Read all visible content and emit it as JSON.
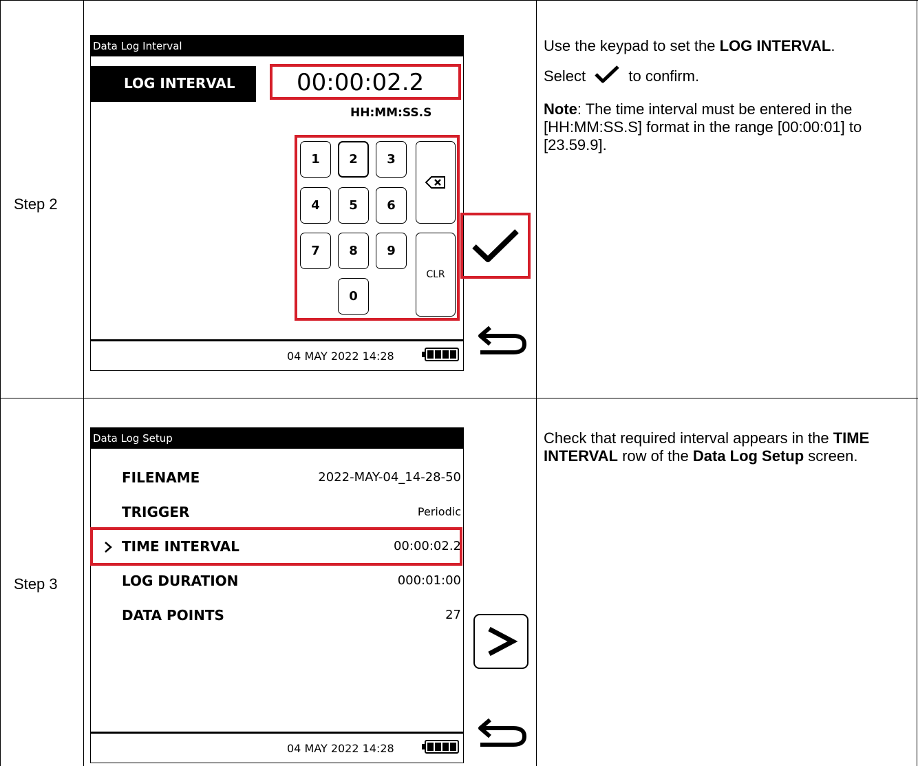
{
  "steps": [
    {
      "label": "Step 2",
      "screen": {
        "title": "Data Log Interval",
        "field_label": "LOG INTERVAL",
        "field_value": "00:00:02.2",
        "format_hint": "HH:MM:SS.S",
        "keys": [
          "1",
          "2",
          "3",
          "4",
          "5",
          "6",
          "7",
          "8",
          "9",
          "0"
        ],
        "clear_label": "CLR",
        "datetime": "04 MAY 2022 14:28"
      },
      "desc": {
        "p1_pre": "Use the keypad to set the ",
        "p1_bold": "LOG INTERVAL",
        "p1_post": ".",
        "p2_pre": "Select ",
        "p2_post": " to confirm.",
        "p3_bold": "Note",
        "p3_post": ": The time interval must be entered in the [HH:MM:SS.S] format in the range [00:00:01] to [23.59.9]."
      }
    },
    {
      "label": "Step 3",
      "screen": {
        "title": "Data Log Setup",
        "rows": [
          {
            "label": "FILENAME",
            "value": "2022-MAY-04_14-28-50"
          },
          {
            "label": "TRIGGER",
            "value": "Periodic"
          },
          {
            "label": "TIME INTERVAL",
            "value": "00:00:02.2"
          },
          {
            "label": "LOG DURATION",
            "value": "000:01:00"
          },
          {
            "label": "DATA POINTS",
            "value": "27"
          }
        ],
        "datetime": "04 MAY 2022 14:28"
      },
      "desc": {
        "t1": "Check that required interval appears in the ",
        "b1": "TIME INTERVAL",
        "t2": " row of the ",
        "b2": "Data Log Setup",
        "t3": " screen."
      }
    }
  ],
  "icons": {
    "confirm": "checkmark-icon",
    "back": "back-arrow-icon",
    "next": "chevron-right-icon",
    "backspace": "backspace-icon",
    "battery": "battery-icon",
    "row_selector": "chevron-right-icon"
  },
  "colors": {
    "highlight": "#d51f2a"
  }
}
